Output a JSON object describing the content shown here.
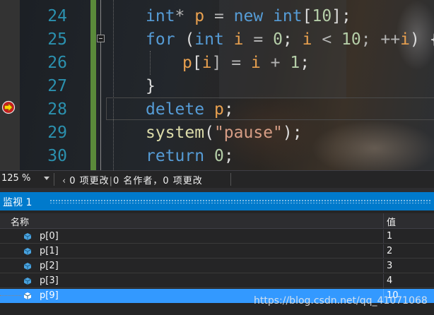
{
  "editor": {
    "lines": [
      {
        "number": "24"
      },
      {
        "number": "25"
      },
      {
        "number": "26"
      },
      {
        "number": "27"
      },
      {
        "number": "28"
      },
      {
        "number": "29"
      },
      {
        "number": "30"
      }
    ],
    "code": {
      "l24": {
        "t1": "int",
        "t2": "* ",
        "t3": "p",
        "t4": " = ",
        "t5": "new",
        "t6": " ",
        "t7": "int",
        "t8": "[",
        "t9": "10",
        "t10": "];"
      },
      "l25": {
        "t1": "for",
        "t2": " (",
        "t3": "int",
        "t4": " ",
        "t5": "i",
        "t6": " = ",
        "t7": "0",
        "t8": "; ",
        "t9": "i",
        "t10": " < ",
        "t11": "10",
        "t12": "; ++",
        "t13": "i",
        "t14": ") {"
      },
      "l26": {
        "t1": "p",
        "t2": "[",
        "t3": "i",
        "t4": "] = ",
        "t5": "i",
        "t6": " + ",
        "t7": "1",
        "t8": ";"
      },
      "l27": {
        "t1": "}"
      },
      "l28": {
        "t1": "delete",
        "t2": " ",
        "t3": "p",
        "t4": ";"
      },
      "l29": {
        "t1": "system",
        "t2": "(",
        "t3": "\"pause\"",
        "t4": ");"
      },
      "l30": {
        "t1": "return",
        "t2": " ",
        "t3": "0",
        "t4": ";"
      }
    },
    "current_line_icon": "current-statement-arrow-icon"
  },
  "status": {
    "zoom": "125 %",
    "changes_arrow": "‹",
    "changes_text": "0 项更改",
    "pipe": "|",
    "authors_text": "0 名作者，0 项更改"
  },
  "watch": {
    "title": "监视 1",
    "col_name": "名称",
    "col_value": "值",
    "rows": [
      {
        "name": "p[0]",
        "value": "1"
      },
      {
        "name": "p[1]",
        "value": "2"
      },
      {
        "name": "p[2]",
        "value": "3"
      },
      {
        "name": "p[3]",
        "value": "4"
      },
      {
        "name": "p[9]",
        "value": "10"
      }
    ],
    "selected_row": 4
  },
  "watermark": "https://blog.csdn.net/qq_41071068",
  "colors": {
    "accent": "#007acc",
    "selection": "#3399ff",
    "keyword": "#569cd6",
    "variable": "#e8a04f",
    "number": "#b5cea8",
    "string": "#d69d85",
    "line_number": "#2b91af"
  }
}
